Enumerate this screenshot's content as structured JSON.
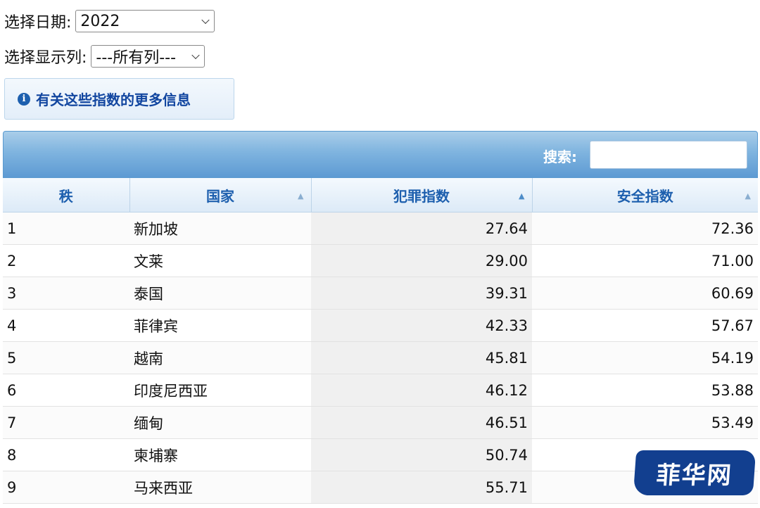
{
  "controls": {
    "date_label": "选择日期:",
    "date_value": "2022",
    "columns_label": "选择显示列:",
    "columns_value": "---所有列---"
  },
  "info_button": {
    "label": "有关这些指数的更多信息",
    "icon": "info-icon"
  },
  "grid": {
    "search_label": "搜索:",
    "search_value": "",
    "columns": [
      "秩",
      "国家",
      "犯罪指数",
      "安全指数"
    ],
    "rows": [
      {
        "rank": "1",
        "country": "新加坡",
        "crime": "27.64",
        "safety": "72.36"
      },
      {
        "rank": "2",
        "country": "文莱",
        "crime": "29.00",
        "safety": "71.00"
      },
      {
        "rank": "3",
        "country": "泰国",
        "crime": "39.31",
        "safety": "60.69"
      },
      {
        "rank": "4",
        "country": "菲律宾",
        "crime": "42.33",
        "safety": "57.67"
      },
      {
        "rank": "5",
        "country": "越南",
        "crime": "45.81",
        "safety": "54.19"
      },
      {
        "rank": "6",
        "country": "印度尼西亚",
        "crime": "46.12",
        "safety": "53.88"
      },
      {
        "rank": "7",
        "country": "缅甸",
        "crime": "46.51",
        "safety": "53.49"
      },
      {
        "rank": "8",
        "country": "柬埔寨",
        "crime": "50.74",
        "safety": ""
      },
      {
        "rank": "9",
        "country": "马来西亚",
        "crime": "55.71",
        "safety": ""
      }
    ]
  },
  "watermark": {
    "text": "菲华网"
  },
  "colors": {
    "header_blue": "#5d9ad3",
    "link_blue": "#1246a0",
    "watermark_bg": "#123f8f"
  }
}
